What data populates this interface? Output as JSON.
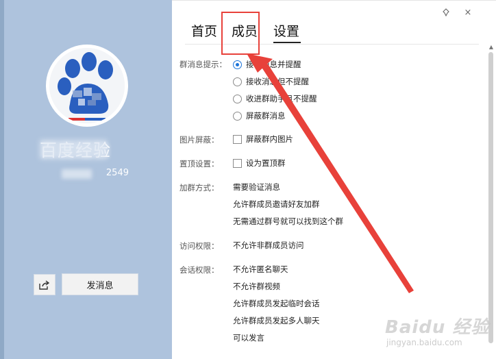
{
  "profile": {
    "group_name": "百度经验",
    "group_id": "2549",
    "share_icon": "share-icon",
    "send_message_label": "发消息"
  },
  "window": {
    "controls": [
      "pin-icon",
      "close-icon"
    ],
    "close_glyph": "×"
  },
  "tabs": [
    {
      "label": "首页",
      "active": false
    },
    {
      "label": "成员",
      "active": false
    },
    {
      "label": "设置",
      "active": true
    }
  ],
  "settings": {
    "group_message": {
      "label": "群消息提示：",
      "options": [
        {
          "label": "接收消息并提醒",
          "selected": true
        },
        {
          "label": "接收消息但不提醒",
          "selected": false
        },
        {
          "label": "收进群助手且不提醒",
          "selected": false
        },
        {
          "label": "屏蔽群消息",
          "selected": false
        }
      ]
    },
    "image_block": {
      "label": "图片屏蔽：",
      "option": "屏蔽群内图片",
      "checked": false
    },
    "pin": {
      "label": "置顶设置：",
      "option": "设为置顶群",
      "checked": false
    },
    "join_method": {
      "label": "加群方式：",
      "values": [
        "需要验证消息",
        "允许群成员邀请好友加群",
        "无需通过群号就可以找到这个群"
      ]
    },
    "access": {
      "label": "访问权限：",
      "value": "不允许非群成员访问"
    },
    "chat_permissions": {
      "label": "会话权限：",
      "values": [
        "不允许匿名聊天",
        "不允许群视频",
        "允许群成员发起临时会话",
        "允许群成员发起多人聊天",
        "可以发言"
      ]
    }
  },
  "annotation": {
    "color": "#e8413a"
  },
  "watermark": {
    "main": "Baidu 经验",
    "sub": "jingyan.baidu.com"
  }
}
